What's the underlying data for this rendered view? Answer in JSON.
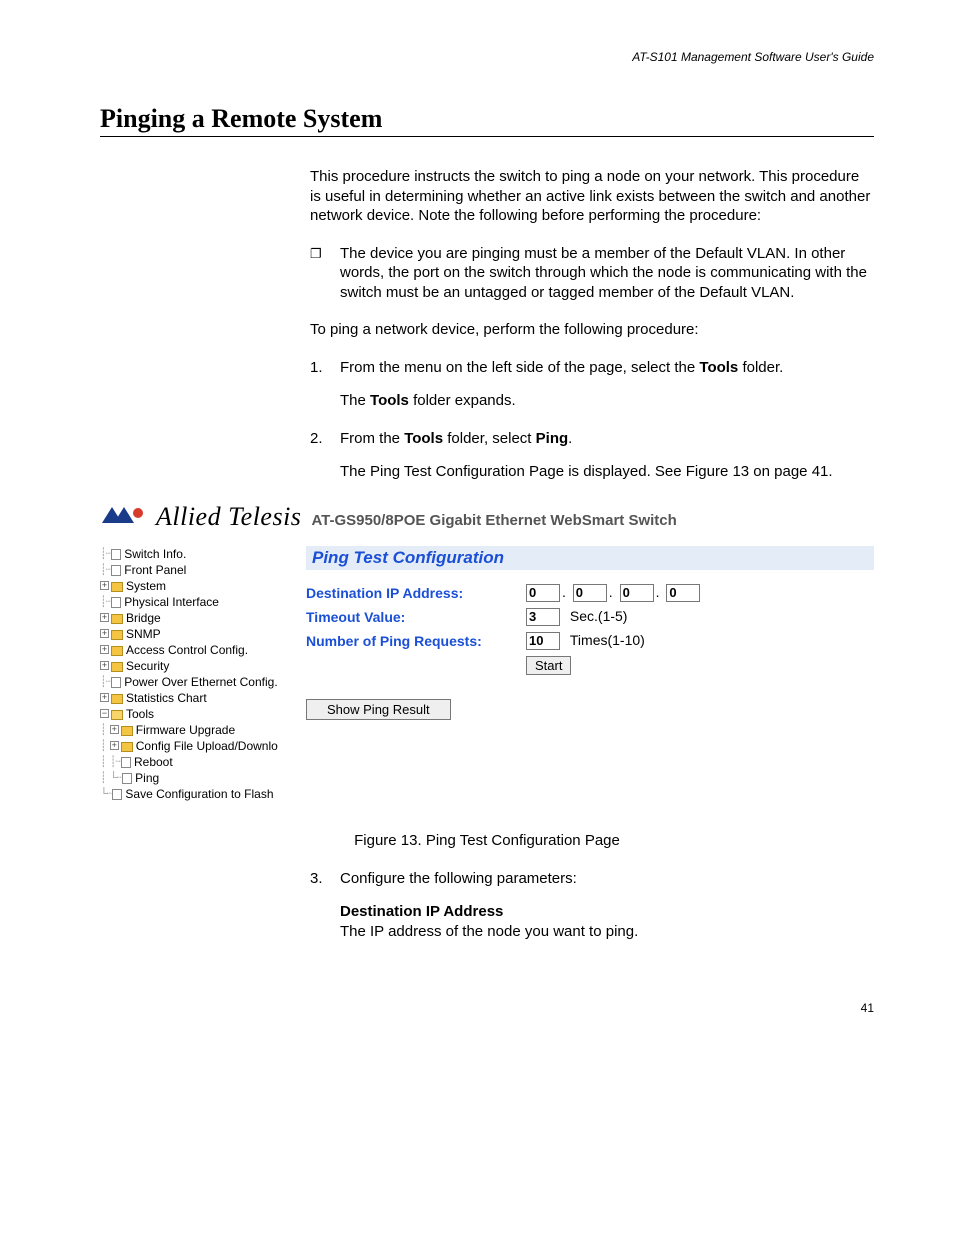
{
  "header": "AT-S101 Management Software User's Guide",
  "section_title": "Pinging a Remote System",
  "intro": "This procedure instructs the switch to ping a node on your network. This procedure is useful in determining whether an active link exists between the switch and another network device. Note the following before performing the procedure:",
  "bullet1": "The device you are pinging must be a member of the Default VLAN. In other words, the port on the switch through which the node is communicating with the switch must be an untagged or tagged member of the Default VLAN.",
  "lead2": "To ping a network device, perform the following procedure:",
  "step1_pre": "From the menu on the left side of the page, select the ",
  "step1_bold": "Tools",
  "step1_post": " folder.",
  "step1_sub_pre": "The ",
  "step1_sub_bold": "Tools",
  "step1_sub_post": " folder expands.",
  "step2_pre": "From the ",
  "step2_bold1": "Tools",
  "step2_mid": " folder, select ",
  "step2_bold2": "Ping",
  "step2_post": ".",
  "step2_sub": "The Ping Test Configuration Page is displayed. See Figure 13 on page 41.",
  "brand_name": "Allied Telesis",
  "brand_sub": "AT-GS950/8POE Gigabit Ethernet WebSmart Switch",
  "tree": {
    "switch_info": "Switch Info.",
    "front_panel": "Front Panel",
    "system": "System",
    "physical_interface": "Physical Interface",
    "bridge": "Bridge",
    "snmp": "SNMP",
    "acc": "Access Control Config.",
    "security": "Security",
    "poe": "Power Over Ethernet Config.",
    "stats": "Statistics Chart",
    "tools": "Tools",
    "firmware": "Firmware Upgrade",
    "config_file": "Config File Upload/Downlo",
    "reboot": "Reboot",
    "ping": "Ping",
    "save": "Save Configuration to Flash"
  },
  "panel": {
    "title": "Ping Test Configuration",
    "dest_label": "Destination IP Address:",
    "timeout_label": "Timeout Value:",
    "num_label": "Number of Ping Requests:",
    "ip": [
      "0",
      "0",
      "0",
      "0"
    ],
    "timeout_val": "3",
    "timeout_unit": "Sec.(1-5)",
    "num_val": "10",
    "num_unit": "Times(1-10)",
    "start": "Start",
    "show": "Show Ping Result"
  },
  "figure_caption": "Figure 13. Ping Test Configuration Page",
  "step3": "Configure the following parameters:",
  "param_title": "Destination IP Address",
  "param_desc": "The IP address of the node you want to ping.",
  "page_num": "41"
}
